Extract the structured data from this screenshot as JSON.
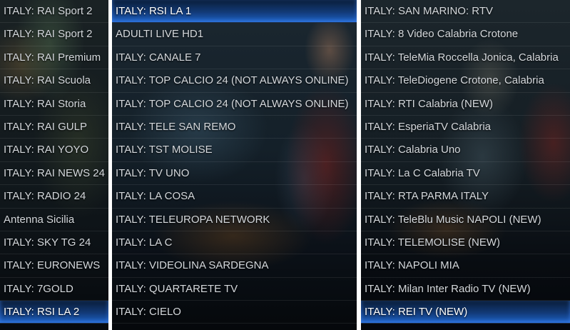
{
  "panels": [
    {
      "items": [
        {
          "label": "ITALY: RAI Sport 2"
        },
        {
          "label": "ITALY: RAI Sport 2"
        },
        {
          "label": "ITALY: RAI Premium"
        },
        {
          "label": "ITALY: RAI Scuola"
        },
        {
          "label": "ITALY: RAI Storia"
        },
        {
          "label": "ITALY: RAI GULP"
        },
        {
          "label": "ITALY: RAI YOYO"
        },
        {
          "label": "ITALY: RAI NEWS 24"
        },
        {
          "label": "ITALY: RADIO 24"
        },
        {
          "label": "Antenna Sicilia"
        },
        {
          "label": "ITALY: SKY TG 24"
        },
        {
          "label": "ITALY: EURONEWS"
        },
        {
          "label": "ITALY: 7GOLD"
        },
        {
          "label": "ITALY: RSI LA 2",
          "selected": true
        }
      ]
    },
    {
      "items": [
        {
          "label": "ITALY: RSI LA 1",
          "selected": true
        },
        {
          "label": "ADULTI LIVE HD1"
        },
        {
          "label": "ITALY: CANALE 7"
        },
        {
          "label": "ITALY: TOP CALCIO 24 (NOT ALWAYS ONLINE)"
        },
        {
          "label": "ITALY: TOP CALCIO 24 (NOT ALWAYS ONLINE)"
        },
        {
          "label": "ITALY: TELE SAN REMO"
        },
        {
          "label": "ITALY: TST MOLISE"
        },
        {
          "label": "ITALY: TV UNO"
        },
        {
          "label": "ITALY: LA COSA"
        },
        {
          "label": "ITALY: TELEUROPA NETWORK"
        },
        {
          "label": "ITALY: LA C"
        },
        {
          "label": "ITALY: VIDEOLINA SARDEGNA"
        },
        {
          "label": "ITALY: QUARTARETE TV"
        },
        {
          "label": "ITALY: CIELO"
        }
      ]
    },
    {
      "items": [
        {
          "label": "ITALY: SAN MARINO: RTV"
        },
        {
          "label": "ITALY: 8 Video Calabria Crotone"
        },
        {
          "label": "ITALY: TeleMia Roccella Jonica, Calabria"
        },
        {
          "label": "ITALY: TeleDiogene  Crotone, Calabria"
        },
        {
          "label": "ITALY: RTI Calabria (NEW)"
        },
        {
          "label": "ITALY: EsperiaTV Calabria"
        },
        {
          "label": "ITALY: Calabria Uno"
        },
        {
          "label": "ITALY: La C Calabria TV"
        },
        {
          "label": "ITALY: RTA PARMA ITALY"
        },
        {
          "label": "ITALY: TeleBlu Music NAPOLI (NEW)"
        },
        {
          "label": "ITALY: TELEMOLISE (NEW)"
        },
        {
          "label": "ITALY: NAPOLI MIA"
        },
        {
          "label": "ITALY: Milan Inter Radio TV (NEW)"
        },
        {
          "label": "ITALY: REI TV (NEW)",
          "selected": true
        }
      ]
    }
  ]
}
